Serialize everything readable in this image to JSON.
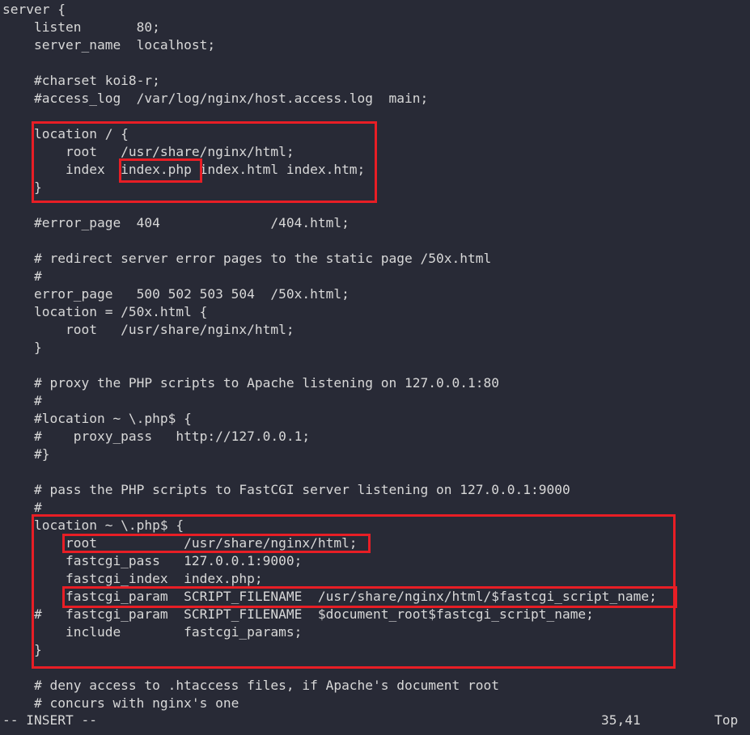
{
  "editor": {
    "lines": [
      "server {",
      "    listen       80;",
      "    server_name  localhost;",
      "",
      "    #charset koi8-r;",
      "    #access_log  /var/log/nginx/host.access.log  main;",
      "",
      "    location / {",
      "        root   /usr/share/nginx/html;",
      "        index  index.php index.html index.htm;",
      "    }",
      "",
      "    #error_page  404              /404.html;",
      "",
      "    # redirect server error pages to the static page /50x.html",
      "    #",
      "    error_page   500 502 503 504  /50x.html;",
      "    location = /50x.html {",
      "        root   /usr/share/nginx/html;",
      "    }",
      "",
      "    # proxy the PHP scripts to Apache listening on 127.0.0.1:80",
      "    #",
      "    #location ~ \\.php$ {",
      "    #    proxy_pass   http://127.0.0.1;",
      "    #}",
      "",
      "    # pass the PHP scripts to FastCGI server listening on 127.0.0.1:9000",
      "    #",
      "    location ~ \\.php$ {",
      "        root           /usr/share/nginx/html;",
      "        fastcgi_pass   127.0.0.1:9000;",
      "        fastcgi_index  index.php;",
      "        fastcgi_param  SCRIPT_FILENAME  /usr/share/nginx/html/$fastcgi_script_name;",
      "    #   fastcgi_param  SCRIPT_FILENAME  $document_root$fastcgi_script_name;",
      "        include        fastcgi_params;",
      "    }",
      "",
      "    # deny access to .htaccess files, if Apache's document root",
      "    # concurs with nginx's one"
    ]
  },
  "statusbar": {
    "mode": "-- INSERT --",
    "position": "35,41",
    "scroll": "Top"
  },
  "highlight_color": "#e81e25"
}
